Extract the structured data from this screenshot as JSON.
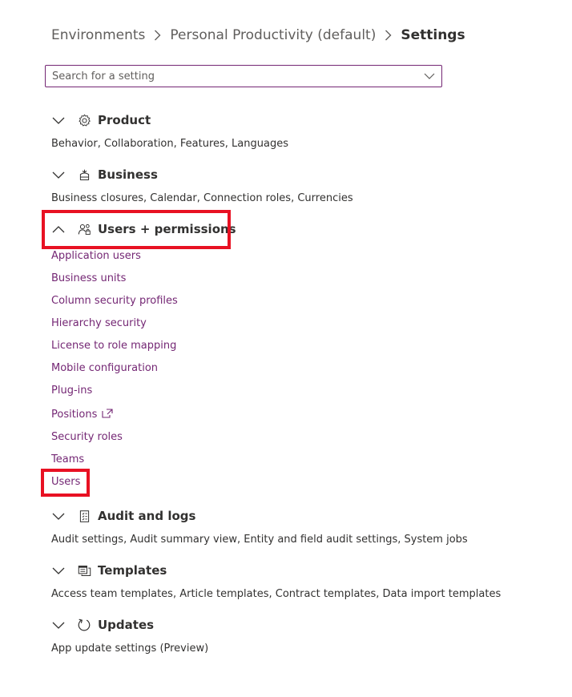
{
  "breadcrumb": {
    "items": [
      "Environments",
      "Personal Productivity (default)"
    ],
    "current": "Settings"
  },
  "search": {
    "placeholder": "Search for a setting"
  },
  "sections": {
    "product": {
      "title": "Product",
      "icon": "gear-icon",
      "summary": "Behavior, Collaboration, Features, Languages"
    },
    "business": {
      "title": "Business",
      "icon": "business-icon",
      "summary": "Business closures, Calendar, Connection roles, Currencies"
    },
    "users_permissions": {
      "title": "Users + permissions",
      "icon": "people-key-icon",
      "links": [
        "Application users",
        "Business units",
        "Column security profiles",
        "Hierarchy security",
        "License to role mapping",
        "Mobile configuration",
        "Plug-ins",
        "Positions",
        "Security roles",
        "Teams",
        "Users"
      ]
    },
    "audit": {
      "title": "Audit and logs",
      "icon": "audit-log-icon",
      "summary": "Audit settings, Audit summary view, Entity and field audit settings, System jobs"
    },
    "templates": {
      "title": "Templates",
      "icon": "templates-icon",
      "summary": "Access team templates, Article templates, Contract templates, Data import templates"
    },
    "updates": {
      "title": "Updates",
      "icon": "refresh-icon",
      "summary": "App update settings (Preview)"
    }
  },
  "colors": {
    "link": "#742774",
    "highlight": "#e81123",
    "text": "#323130"
  }
}
